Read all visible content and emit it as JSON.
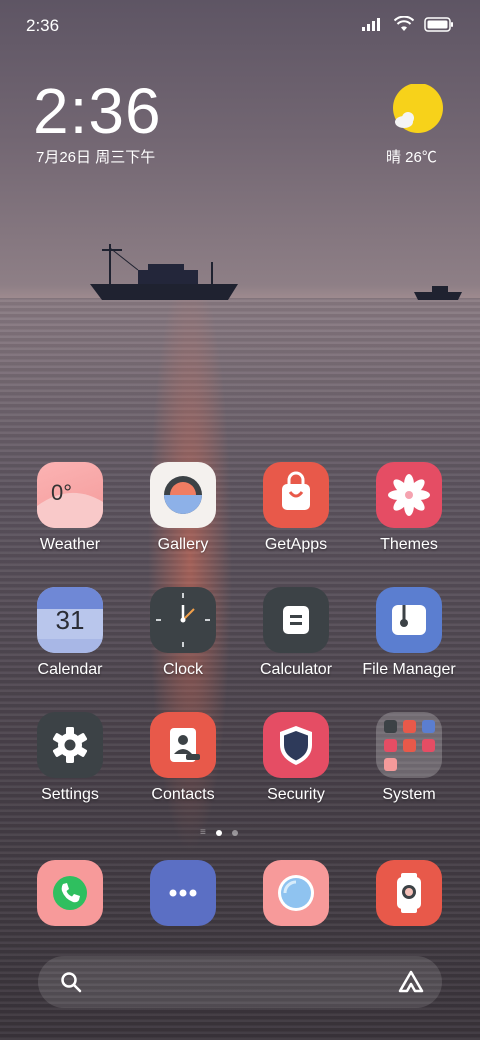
{
  "status_bar": {
    "time": "2:36",
    "signal_icon": "signal-icon",
    "wifi_icon": "wifi-icon",
    "battery_icon": "battery-icon"
  },
  "lock_widget": {
    "time": "2:36",
    "date": "7月26日 周三下午",
    "weather": "晴 26℃",
    "weather_icon": "sun-icon"
  },
  "apps_row1": [
    {
      "label": "Weather",
      "icon": "weather-icon",
      "tile_text": "0°"
    },
    {
      "label": "Gallery",
      "icon": "gallery-icon"
    },
    {
      "label": "GetApps",
      "icon": "shopping-bag-icon"
    },
    {
      "label": "Themes",
      "icon": "flower-icon"
    }
  ],
  "apps_row2": [
    {
      "label": "Calendar",
      "icon": "calendar-icon",
      "tile_text": "31"
    },
    {
      "label": "Clock",
      "icon": "clock-icon"
    },
    {
      "label": "Calculator",
      "icon": "calculator-icon"
    },
    {
      "label": "File Manager",
      "icon": "folder-icon"
    }
  ],
  "apps_row3": [
    {
      "label": "Settings",
      "icon": "gear-icon"
    },
    {
      "label": "Contacts",
      "icon": "contacts-icon"
    },
    {
      "label": "Security",
      "icon": "shield-icon"
    },
    {
      "label": "System",
      "icon": "folder-grid-icon"
    }
  ],
  "dock": [
    {
      "icon": "phone-icon"
    },
    {
      "icon": "messages-icon"
    },
    {
      "icon": "browser-icon"
    },
    {
      "icon": "camera-icon"
    }
  ],
  "page_indicator": {
    "pages": 3,
    "active": 1
  },
  "search": {
    "search_icon": "search-icon",
    "assistant_icon": "assistant-icon"
  },
  "colors": {
    "gallery_bg": "#f4f1ee",
    "getapps_bg": "#e8594a",
    "themes_bg": "#e54d64",
    "weather_bg": "#f7a8a8",
    "clock_bg": "#3c4246",
    "calc_bg": "#3c4246",
    "files_bg": "#5b7ed0",
    "settings_bg": "#3c4246",
    "contacts_bg": "#e8594a",
    "security_bg": "#e54d64",
    "phone_bg": "#f79a9a",
    "messages_bg": "#5b6fc4",
    "browser_bg": "#f79a9a",
    "camera_bg": "#e8594a"
  }
}
